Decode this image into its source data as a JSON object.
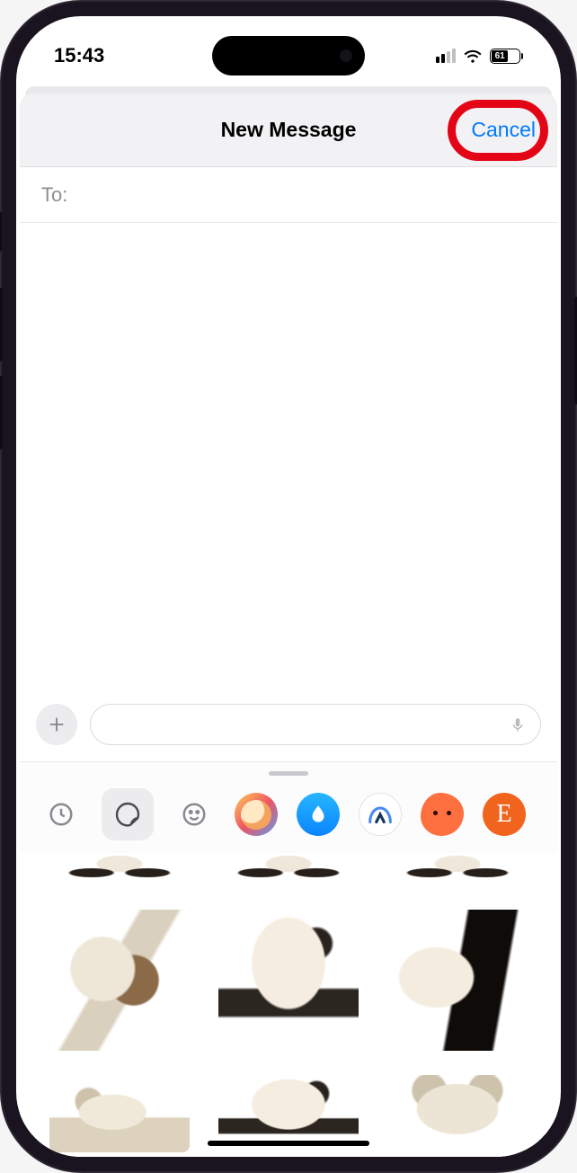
{
  "status_bar": {
    "time": "15:43",
    "battery_pct": "61"
  },
  "nav": {
    "title": "New Message",
    "cancel": "Cancel"
  },
  "compose": {
    "to_label": "To:"
  },
  "app_strip": {
    "etsy_glyph": "E"
  },
  "annotation": {
    "highlight_target": "cancel-button"
  }
}
